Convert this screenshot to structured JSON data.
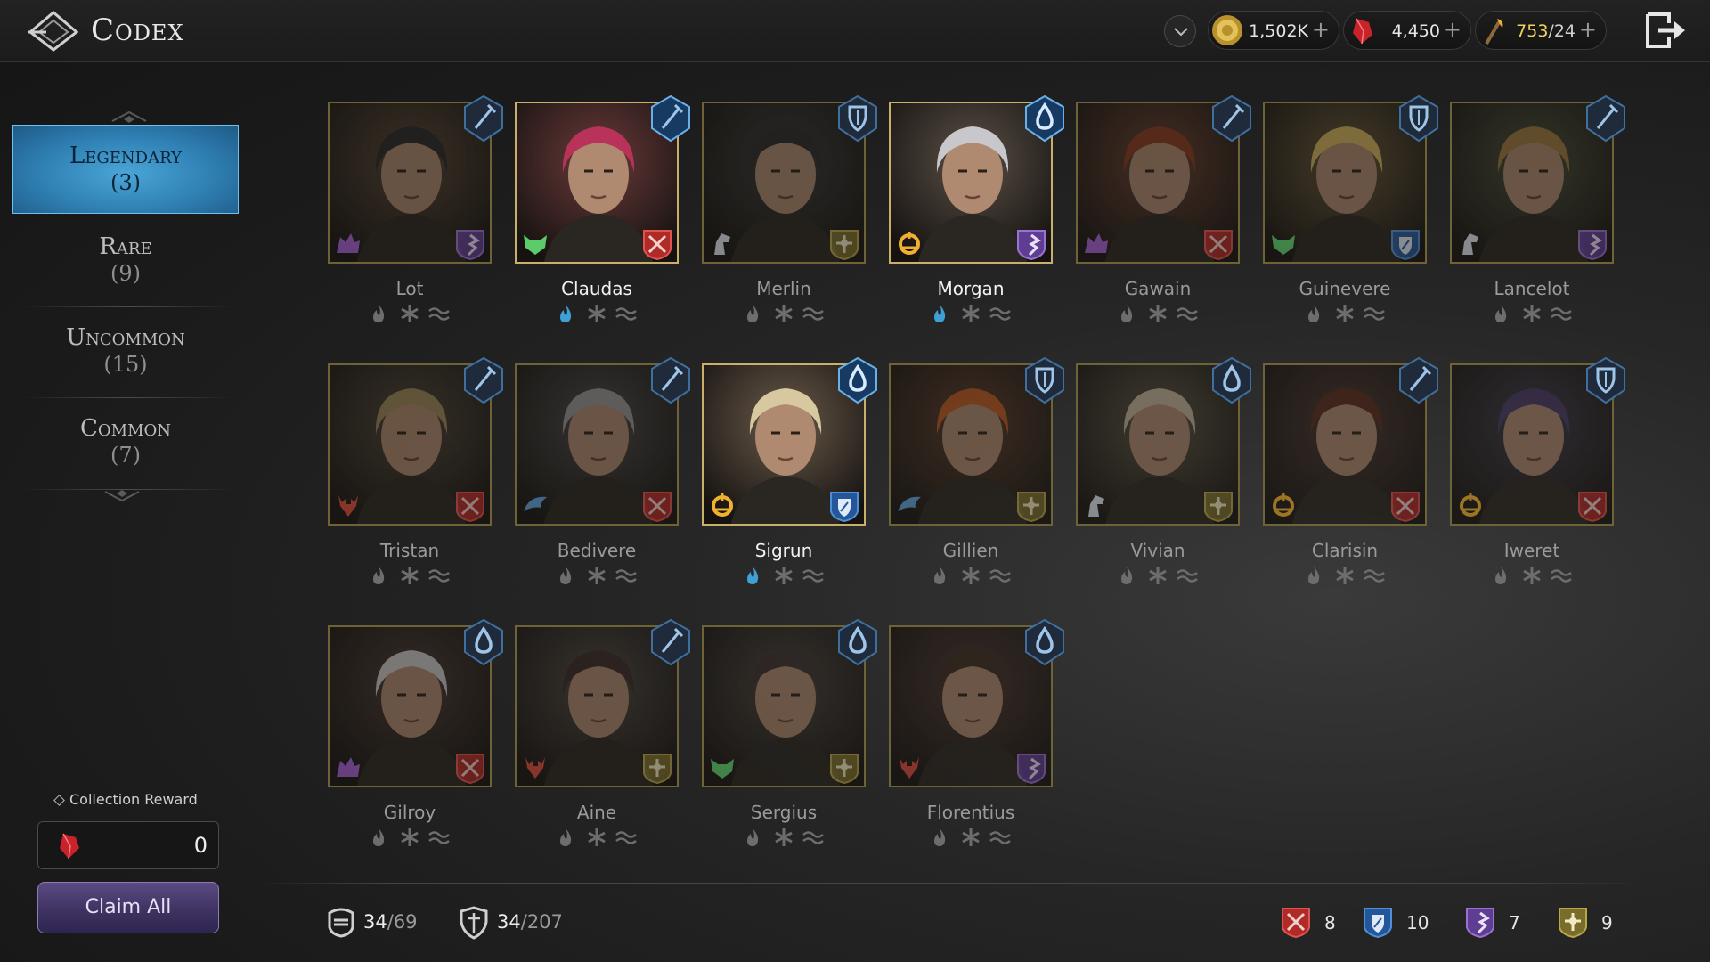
{
  "header": {
    "title": "Codex",
    "resources": [
      {
        "name": "gold",
        "value": "1,502K",
        "plus": "+"
      },
      {
        "name": "crystal",
        "value": "4,450",
        "plus": "+"
      },
      {
        "name": "stamina",
        "current": "753",
        "separator": "/",
        "max": "24",
        "plus": "+"
      }
    ]
  },
  "sidebar": {
    "rarities": [
      {
        "label": "Legendary",
        "count": "(3)"
      },
      {
        "label": "Rare",
        "count": "(9)"
      },
      {
        "label": "Uncommon",
        "count": "(15)"
      },
      {
        "label": "Common",
        "count": "(7)"
      }
    ],
    "collection_reward_label": "Collection Reward",
    "collection_reward_value": "0",
    "claim_label": "Claim All"
  },
  "heroes": [
    {
      "name": "Lot",
      "owned": false,
      "class": "sword",
      "race": "wolf",
      "race_color": "#9b5cc8",
      "role": "mage",
      "awakened": false
    },
    {
      "name": "Claudas",
      "owned": true,
      "class": "sword",
      "race": "fox",
      "race_color": "#5ccb6a",
      "role": "warrior",
      "awakened": true
    },
    {
      "name": "Merlin",
      "owned": false,
      "class": "shield",
      "race": "horse",
      "race_color": "#cfd7e0",
      "role": "support",
      "awakened": false
    },
    {
      "name": "Morgan",
      "owned": true,
      "class": "water",
      "race": "sun",
      "race_color": "#f0b030",
      "role": "mage",
      "awakened": true
    },
    {
      "name": "Gawain",
      "owned": false,
      "class": "sword",
      "race": "wolf",
      "race_color": "#9b5cc8",
      "role": "warrior",
      "awakened": false
    },
    {
      "name": "Guinevere",
      "owned": false,
      "class": "shield",
      "race": "fox",
      "race_color": "#5ccb6a",
      "role": "tank",
      "awakened": false
    },
    {
      "name": "Lancelot",
      "owned": false,
      "class": "sword",
      "race": "horse",
      "race_color": "#cfd7e0",
      "role": "mage",
      "awakened": false
    },
    {
      "name": "Tristan",
      "owned": false,
      "class": "sword",
      "race": "deer",
      "race_color": "#d14a3c",
      "role": "warrior",
      "awakened": false
    },
    {
      "name": "Bedivere",
      "owned": false,
      "class": "sword",
      "race": "eagle",
      "race_color": "#5a9ad0",
      "role": "warrior",
      "awakened": false
    },
    {
      "name": "Sigrun",
      "owned": true,
      "class": "water",
      "race": "sun",
      "race_color": "#f0b030",
      "role": "tank",
      "awakened": true
    },
    {
      "name": "Gillien",
      "owned": false,
      "class": "shield",
      "race": "eagle",
      "race_color": "#5a9ad0",
      "role": "support",
      "awakened": false
    },
    {
      "name": "Vivian",
      "owned": false,
      "class": "water",
      "race": "horse",
      "race_color": "#cfd7e0",
      "role": "support",
      "awakened": false
    },
    {
      "name": "Clarisin",
      "owned": false,
      "class": "sword",
      "race": "sun",
      "race_color": "#f0b030",
      "role": "warrior",
      "awakened": false
    },
    {
      "name": "Iweret",
      "owned": false,
      "class": "shield",
      "race": "sun",
      "race_color": "#f0b030",
      "role": "warrior",
      "awakened": false
    },
    {
      "name": "Gilroy",
      "owned": false,
      "class": "water",
      "race": "wolf",
      "race_color": "#9b5cc8",
      "role": "warrior",
      "awakened": false
    },
    {
      "name": "Aine",
      "owned": false,
      "class": "sword",
      "race": "deer",
      "race_color": "#d14a3c",
      "role": "support",
      "awakened": false
    },
    {
      "name": "Sergius",
      "owned": false,
      "class": "water",
      "race": "fox",
      "race_color": "#5ccb6a",
      "role": "support",
      "awakened": false
    },
    {
      "name": "Florentius",
      "owned": false,
      "class": "water",
      "race": "deer",
      "race_color": "#d14a3c",
      "role": "mage",
      "awakened": false
    }
  ],
  "footer": {
    "heroes_collected": {
      "current": "34",
      "separator": "/",
      "total": "69"
    },
    "gear_collected": {
      "current": "34",
      "separator": "/",
      "total": "207"
    },
    "role_counts": [
      {
        "role": "warrior",
        "count": "8",
        "color": "#c8302c"
      },
      {
        "role": "tank",
        "count": "10",
        "color": "#2f6fb8"
      },
      {
        "role": "mage",
        "count": "7",
        "color": "#7a4fb0"
      },
      {
        "role": "support",
        "count": "9",
        "color": "#9a8a3a"
      }
    ]
  },
  "colors": {
    "accent_blue": "#3f9fd6",
    "gold": "#c9b06a",
    "claim_purple": "#4a3c70"
  }
}
